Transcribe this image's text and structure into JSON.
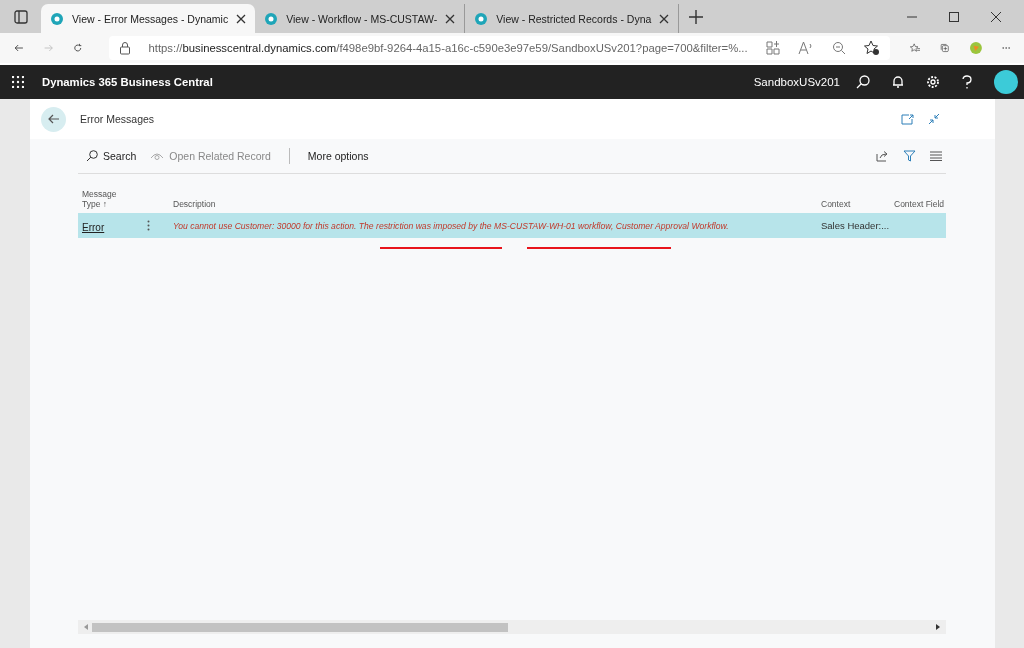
{
  "browser": {
    "tabs": [
      {
        "label": "View - Error Messages - Dynamic",
        "selected": true
      },
      {
        "label": "View - Workflow - MS-CUSTAW-",
        "selected": false
      },
      {
        "label": "View - Restricted Records - Dyna",
        "selected": false
      }
    ],
    "url": {
      "prefix": "https://",
      "host": "businesscentral.dynamics.com",
      "path": "/f498e9bf-9264-4a15-a16c-c590e3e97e59/SandboxUSv201?page=700&filter=%..."
    }
  },
  "app": {
    "title": "Dynamics 365 Business Central",
    "environment": "SandboxUSv201"
  },
  "page": {
    "title": "Error Messages",
    "actions": [
      {
        "label": "Search",
        "disabled": false,
        "kind": "search"
      },
      {
        "label": "Open Related Record",
        "disabled": true,
        "kind": "open"
      },
      {
        "label": "More options",
        "disabled": false,
        "kind": "more"
      }
    ],
    "table": {
      "columns": [
        "Message Type ↑",
        "Description",
        "Context",
        "Context Field"
      ],
      "rows": [
        {
          "selected": true,
          "message_type": "Error",
          "description": "You cannot use Customer: 30000 for this action. The restriction was imposed by the MS-CUSTAW-WH-01 workflow, Customer Approval Workflow.",
          "context": "Sales Header:..."
        }
      ]
    }
  }
}
